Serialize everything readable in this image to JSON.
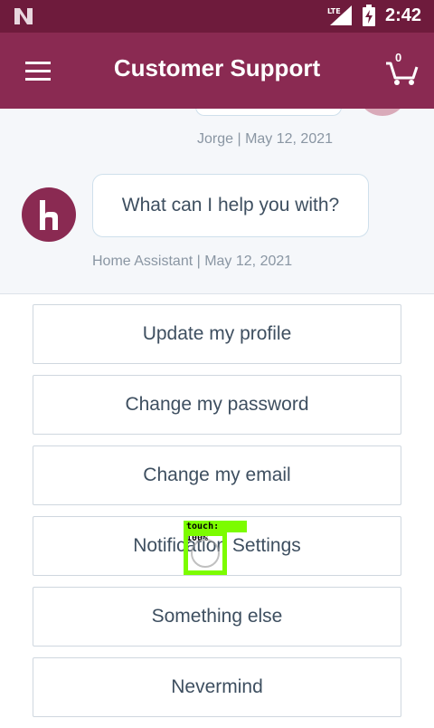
{
  "status_bar": {
    "time": "2:42",
    "network": "LTE",
    "icons": [
      "n-logo-icon",
      "signal-icon",
      "battery-charging-icon"
    ]
  },
  "app_bar": {
    "title": "Customer Support",
    "cart_count": "0",
    "icons": [
      "hamburger-menu-icon",
      "shopping-cart-icon"
    ]
  },
  "chat": {
    "previous_message_meta": "Jorge | May 12, 2021",
    "bot_message": "What can I help you with?",
    "bot_message_meta": "Home Assistant | May 12, 2021",
    "bot_avatar_letter": "h"
  },
  "options": [
    {
      "label": "Update my profile"
    },
    {
      "label": "Change my password"
    },
    {
      "label": "Change my email"
    },
    {
      "label": "Notification Settings"
    },
    {
      "label": "Something else"
    },
    {
      "label": "Nevermind"
    }
  ],
  "touch_indicator": {
    "label": "touch: 100%"
  },
  "colors": {
    "status_bar": "#6e1b3c",
    "app_bar": "#8a2a52",
    "chat_background": "#f5f7fa",
    "text": "#3e4f60",
    "meta_text": "#8a96a3",
    "touch": "#7cfc00"
  }
}
